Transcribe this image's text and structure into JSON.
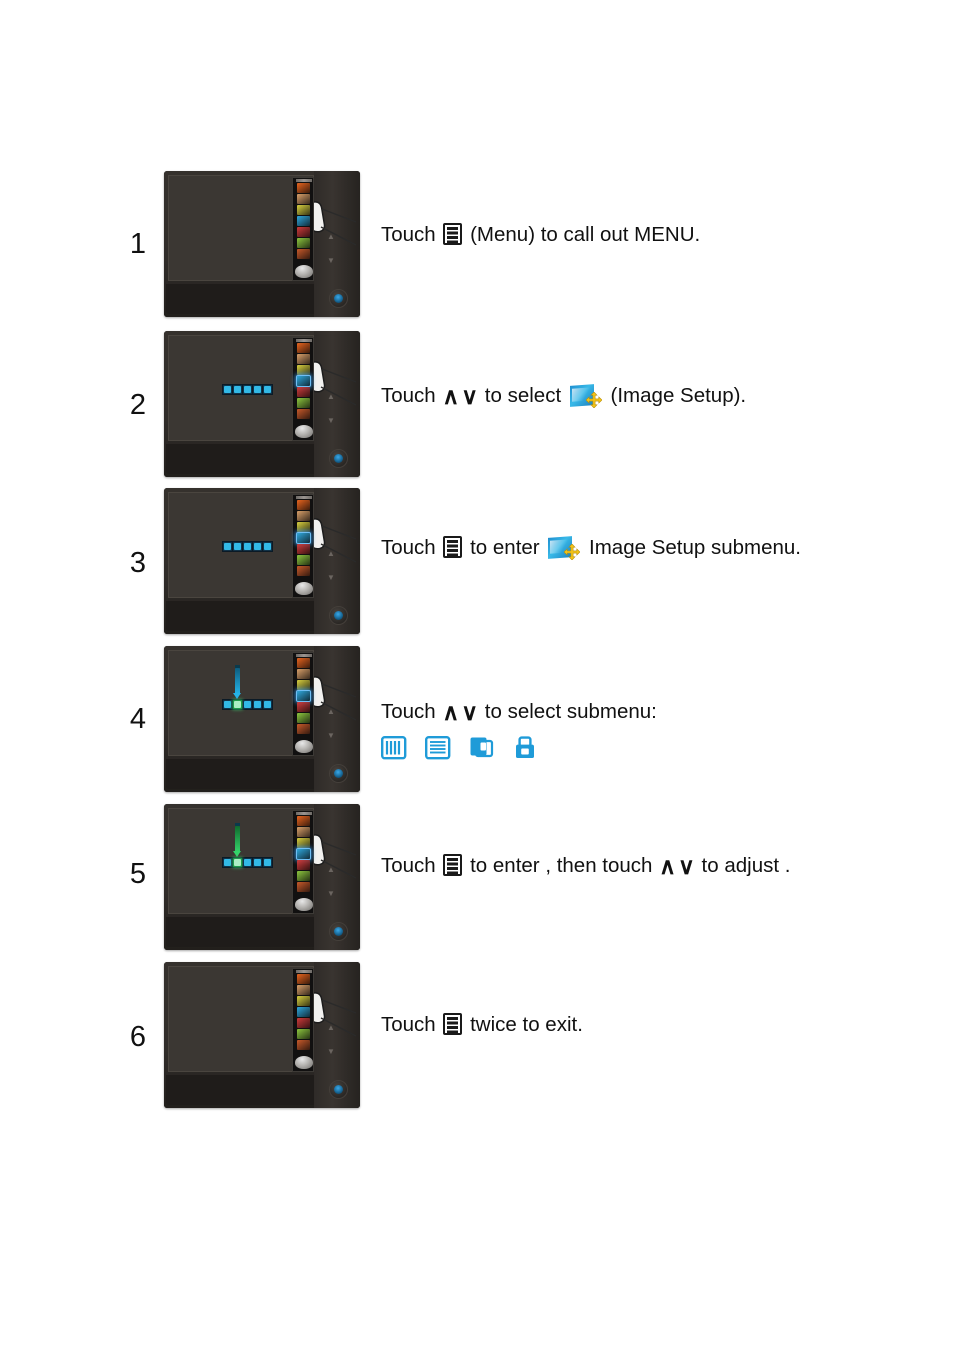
{
  "document": {
    "type": "monitor-osd-instruction-sheet",
    "background_color": "#ffffff"
  },
  "colors": {
    "accent_blue": "#1f9bd8",
    "icon_blue": "#35c4f5",
    "select_green": "#35d36a",
    "crosshair_yellow": "#f5c518",
    "text": "#111111",
    "monitor_body": "#2b2724",
    "screen": "#3b3733"
  },
  "steps": [
    {
      "number": "1",
      "text_parts": [
        {
          "kind": "text",
          "value": "Touch "
        },
        {
          "kind": "icon",
          "value": "menu-icon"
        },
        {
          "kind": "text",
          "value": " (Menu) to  call out MENU."
        }
      ],
      "plain_text": "Touch (Menu) to  call out MENU.",
      "monitor": {
        "osd_strip_visible": true,
        "osd_strip_highlight_index": null,
        "submenu_row_visible": false,
        "pointer_bar": null
      }
    },
    {
      "number": "2",
      "text_parts": [
        {
          "kind": "text",
          "value": "Touch "
        },
        {
          "kind": "icon",
          "value": "chevron-up-icon"
        },
        {
          "kind": "icon",
          "value": "chevron-down-icon"
        },
        {
          "kind": "text",
          "value": " to select "
        },
        {
          "kind": "icon",
          "value": "image-setup-icon"
        },
        {
          "kind": "text",
          "value": " (Image Setup)."
        }
      ],
      "plain_text": "Touch ∧ ∨ to select (Image Setup).",
      "monitor": {
        "osd_strip_visible": true,
        "osd_strip_highlight_index": 3,
        "submenu_row_visible": true,
        "submenu_selected_index": null,
        "pointer_bar": null
      }
    },
    {
      "number": "3",
      "text_parts": [
        {
          "kind": "text",
          "value": "Touch "
        },
        {
          "kind": "icon",
          "value": "menu-icon"
        },
        {
          "kind": "text",
          "value": " to enter "
        },
        {
          "kind": "icon",
          "value": "image-setup-icon"
        },
        {
          "kind": "text",
          "value": " Image Setup  submenu."
        }
      ],
      "plain_text": "Touch to enter Image Setup  submenu.",
      "monitor": {
        "osd_strip_visible": true,
        "osd_strip_highlight_index": 3,
        "submenu_row_visible": true,
        "submenu_selected_index": null,
        "pointer_bar": null
      }
    },
    {
      "number": "4",
      "text_parts": [
        {
          "kind": "text",
          "value": "Touch "
        },
        {
          "kind": "icon",
          "value": "chevron-up-icon"
        },
        {
          "kind": "icon",
          "value": "chevron-down-icon"
        },
        {
          "kind": "text",
          "value": " to select submenu:"
        }
      ],
      "plain_text": "Touch ∧ ∨ to select submenu:",
      "submenu_icons": [
        "clock-bars-icon",
        "phase-lines-icon",
        "position-squares-icon",
        "aspect-ratio-icon"
      ],
      "monitor": {
        "osd_strip_visible": true,
        "osd_strip_highlight_index": 3,
        "submenu_row_visible": true,
        "submenu_selected_index": 1,
        "pointer_bar": "cyan"
      }
    },
    {
      "number": "5",
      "text_parts": [
        {
          "kind": "text",
          "value": "Touch "
        },
        {
          "kind": "icon",
          "value": "menu-icon"
        },
        {
          "kind": "text",
          "value": "  to enter , then touch "
        },
        {
          "kind": "icon",
          "value": "chevron-up-icon"
        },
        {
          "kind": "icon",
          "value": "chevron-down-icon"
        },
        {
          "kind": "text",
          "value": " to  adjust ."
        }
      ],
      "plain_text": "Touch  to enter , then touch ∧ ∨ to  adjust .",
      "monitor": {
        "osd_strip_visible": true,
        "osd_strip_highlight_index": 3,
        "submenu_row_visible": true,
        "submenu_selected_index": 1,
        "pointer_bar": "green"
      }
    },
    {
      "number": "6",
      "text_parts": [
        {
          "kind": "text",
          "value": "Touch "
        },
        {
          "kind": "icon",
          "value": "menu-icon"
        },
        {
          "kind": "text",
          "value": "  twice to exit."
        }
      ],
      "plain_text": "Touch  twice to exit.",
      "monitor": {
        "osd_strip_visible": true,
        "osd_strip_highlight_index": null,
        "submenu_row_visible": false,
        "pointer_bar": null
      }
    }
  ],
  "osd_strip_icons": [
    {
      "name": "brightness-contrast-icon",
      "color": "#e8641e"
    },
    {
      "name": "auto-adjust-icon",
      "color": "#d9a06a"
    },
    {
      "name": "input-source-icon",
      "color": "#d8d040"
    },
    {
      "name": "image-setup-icon",
      "color": "#2fa8dd"
    },
    {
      "name": "color-settings-icon",
      "color": "#cf3b3b"
    },
    {
      "name": "display-settings-icon",
      "color": "#8dc73f"
    },
    {
      "name": "other-settings-icon",
      "color": "#c85a2a"
    },
    {
      "name": "personalize-icon",
      "color": "#b9b6b2"
    }
  ],
  "osd_submenu_row_cells": [
    "clock-bars-icon",
    "phase-lines-icon",
    "position-squares-icon",
    "aspect-ratio-icon",
    "exit-icon"
  ],
  "monitor_controls": {
    "chevron_up": "▲",
    "chevron_down": "▼",
    "power_button": "power-button"
  }
}
